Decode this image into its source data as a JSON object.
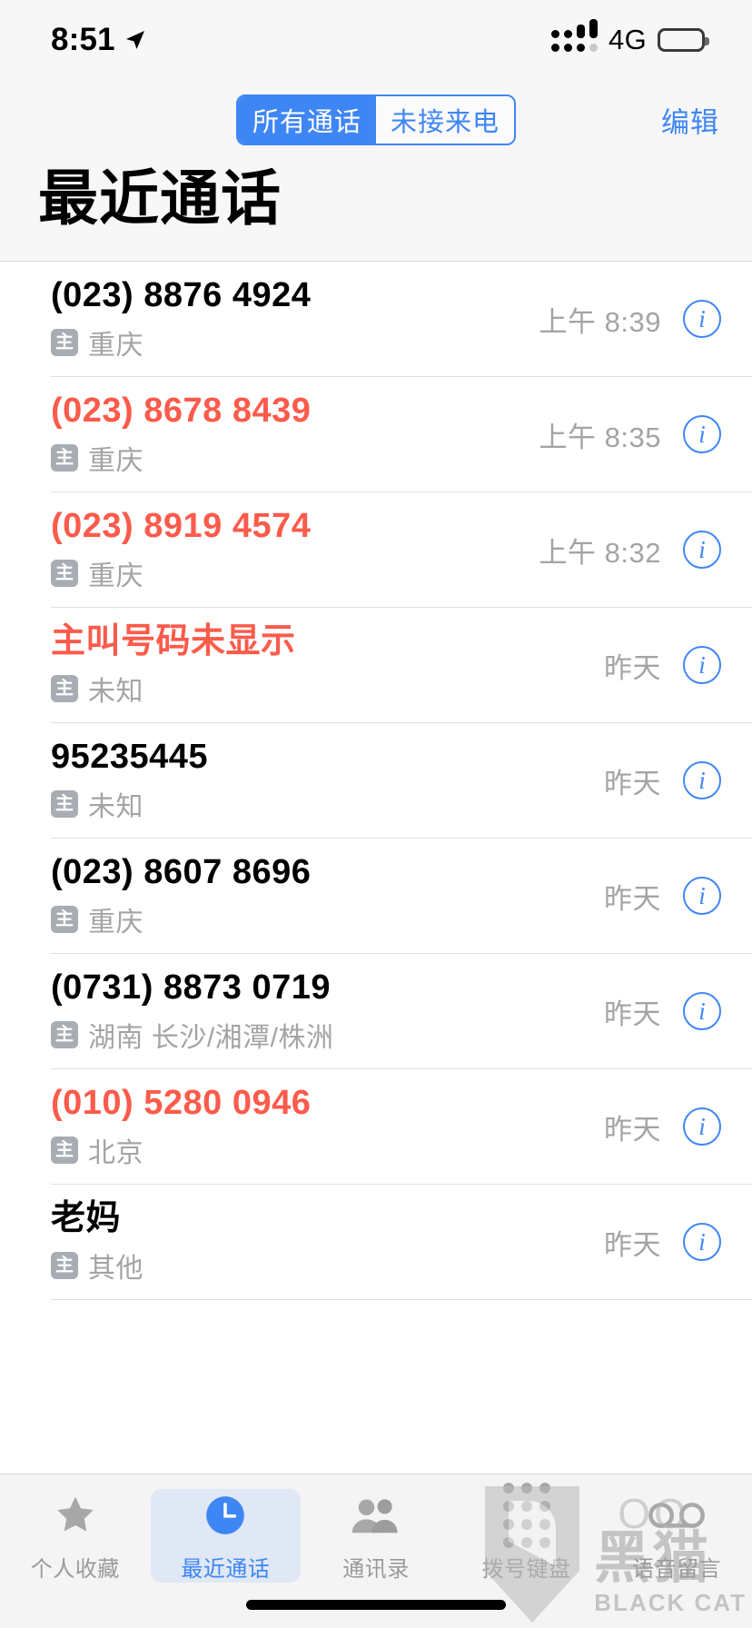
{
  "status_bar": {
    "time": "8:51",
    "location_icon": "location-arrow-icon",
    "carrier_network": "4G",
    "signal_icon": "signal-bars-icon",
    "battery_icon": "battery-full-icon"
  },
  "nav": {
    "segments": [
      {
        "label": "所有通话",
        "active": true
      },
      {
        "label": "未接来电",
        "active": false
      }
    ],
    "edit_label": "编辑",
    "title": "最近通话"
  },
  "colors": {
    "accent": "#3f86f5",
    "missed": "#fb5b4b",
    "secondary_text": "#a4a4a4",
    "badge_bg": "#a8acb3",
    "nav_bg": "#f7f7f7",
    "tabbar_bg": "#f4f4f4"
  },
  "calls": [
    {
      "title": "(023) 8876 4924",
      "sim": "主",
      "location": "重庆",
      "time": "上午 8:39",
      "missed": false,
      "info": "i"
    },
    {
      "title": "(023) 8678 8439",
      "sim": "主",
      "location": "重庆",
      "time": "上午 8:35",
      "missed": true,
      "info": "i"
    },
    {
      "title": "(023) 8919 4574",
      "sim": "主",
      "location": "重庆",
      "time": "上午 8:32",
      "missed": true,
      "info": "i"
    },
    {
      "title": "主叫号码未显示",
      "sim": "主",
      "location": "未知",
      "time": "昨天",
      "missed": true,
      "info": "i"
    },
    {
      "title": "95235445",
      "sim": "主",
      "location": "未知",
      "time": "昨天",
      "missed": false,
      "info": "i"
    },
    {
      "title": "(023) 8607 8696",
      "sim": "主",
      "location": "重庆",
      "time": "昨天",
      "missed": false,
      "info": "i"
    },
    {
      "title": "(0731) 8873 0719",
      "sim": "主",
      "location": "湖南 长沙/湘潭/株洲",
      "time": "昨天",
      "missed": false,
      "info": "i"
    },
    {
      "title": "(010) 5280 0946",
      "sim": "主",
      "location": "北京",
      "time": "昨天",
      "missed": true,
      "info": "i"
    },
    {
      "title": "老妈",
      "sim": "主",
      "location": "其他",
      "time": "昨天",
      "missed": false,
      "info": "i"
    }
  ],
  "tab_bar": {
    "tabs": [
      {
        "label": "个人收藏",
        "icon": "star-icon",
        "active": false
      },
      {
        "label": "最近通话",
        "icon": "clock-icon",
        "active": true
      },
      {
        "label": "通讯录",
        "icon": "contacts-icon",
        "active": false
      },
      {
        "label": "拨号键盘",
        "icon": "keypad-icon",
        "active": false
      },
      {
        "label": "语音留言",
        "icon": "voicemail-icon",
        "active": false
      }
    ]
  },
  "watermark": {
    "eyes": "OO",
    "chinese": "黑猫",
    "english": "BLACK CAT"
  }
}
